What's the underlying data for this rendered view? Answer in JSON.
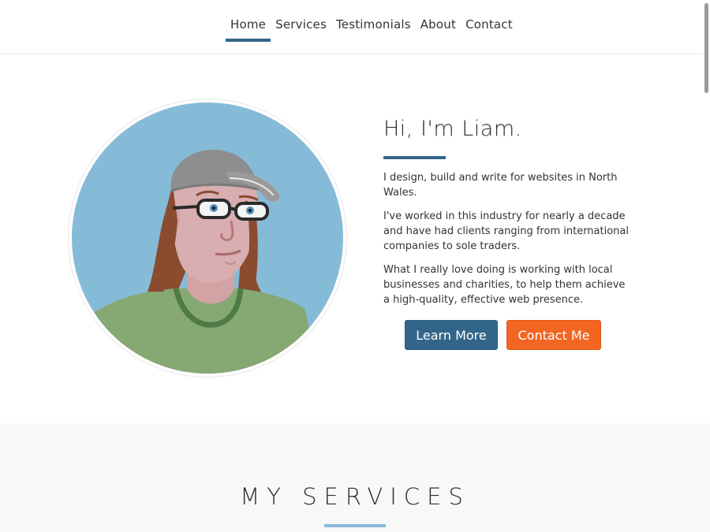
{
  "nav": {
    "items": [
      {
        "label": "Home",
        "active": true
      },
      {
        "label": "Services",
        "active": false
      },
      {
        "label": "Testimonials",
        "active": false
      },
      {
        "label": "About",
        "active": false
      },
      {
        "label": "Contact",
        "active": false
      }
    ]
  },
  "hero": {
    "heading": "Hi, I'm Liam.",
    "paragraphs": [
      "I design, build and write for websites in North Wales.",
      "I've worked in this industry for nearly a decade and have had clients ranging from international companies to sole traders.",
      "What I really love doing is working with local businesses and charities, to help them achieve a high-quality, effective web presence."
    ],
    "learn_more_label": "Learn More",
    "contact_me_label": "Contact Me"
  },
  "services": {
    "title": "MY SERVICES"
  },
  "colors": {
    "primary": "#33658a",
    "accent_orange": "#f26522",
    "avatar_bg": "#86bbd8",
    "shirt": "#86a873"
  },
  "icons": {
    "avatar": "avatar-illustration"
  }
}
